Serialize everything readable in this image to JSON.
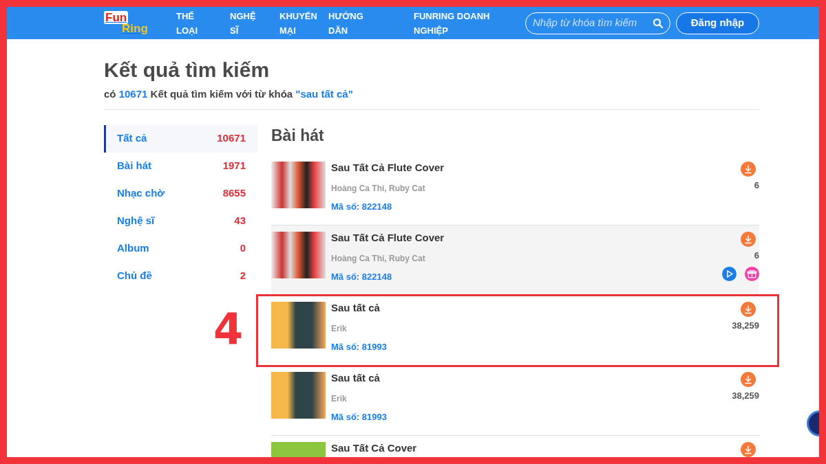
{
  "navbar": {
    "logo": {
      "part_1": "Fun",
      "part_2": "Ring"
    },
    "menu": [
      {
        "label": "THỂ LOẠI"
      },
      {
        "label": "NGHỆ SĨ"
      },
      {
        "label": "KHUYẾN MẠI"
      },
      {
        "label": "HƯỚNG DẪN"
      },
      {
        "label": "FUNRING DOANH NGHIỆP"
      }
    ],
    "search": {
      "placeholder": "Nhập từ khóa tìm kiếm"
    },
    "login_button": "Đăng nhập"
  },
  "title": "Kết quả tìm kiếm",
  "summary": {
    "prefix": "có",
    "count": "10671",
    "middle": "Kết quả tìm kiếm với từ khóa",
    "keyword": "\"sau tất cả\""
  },
  "categories": [
    {
      "label": "Tất cả",
      "count": "10671",
      "selected": true
    },
    {
      "label": "Bài hát",
      "count": "1971",
      "selected": false
    },
    {
      "label": "Nhạc chờ",
      "count": "8655",
      "selected": false
    },
    {
      "label": "Nghệ sĩ",
      "count": "43",
      "selected": false
    },
    {
      "label": "Album",
      "count": "0",
      "selected": false
    },
    {
      "label": "Chủ đề",
      "count": "2",
      "selected": false
    }
  ],
  "section_title": "Bài hát",
  "songs": [
    {
      "kind": "group",
      "title": "Sau Tất Cả Flute Cover",
      "artist": "Hoàng Ca Thi, Ruby Cat",
      "code": "Mã số: 822148",
      "downloads": "6",
      "hovered": false,
      "highlighted": false
    },
    {
      "kind": "group",
      "title": "Sau Tất Cả Flute Cover",
      "artist": "Hoàng Ca Thi, Ruby Cat",
      "code": "Mã số: 822148",
      "downloads": "6",
      "hovered": true,
      "highlighted": false
    },
    {
      "kind": "portrait",
      "title": "Sau tất cả",
      "artist": "Erik",
      "code": "Mã số: 81993",
      "downloads": "38,259",
      "hovered": false,
      "highlighted": true
    },
    {
      "kind": "portrait",
      "title": "Sau tất cả",
      "artist": "Erik",
      "code": "Mã số: 81993",
      "downloads": "38,259",
      "hovered": false,
      "highlighted": false
    },
    {
      "kind": "cover",
      "title": "Sau Tất Cả Cover",
      "highlighted": false
    }
  ],
  "annotation": {
    "label": "4"
  }
}
